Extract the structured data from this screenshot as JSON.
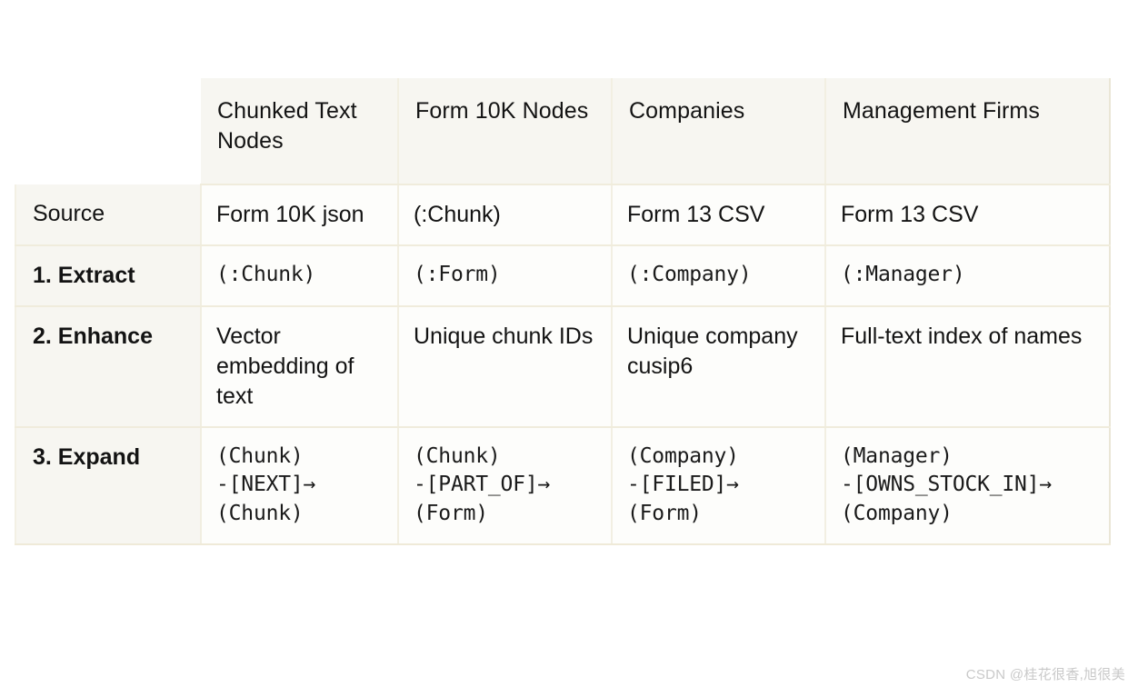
{
  "table": {
    "corner_label": "",
    "columns": [
      "Chunked Text Nodes",
      "Form 10K Nodes",
      "Companies",
      "Management Firms"
    ],
    "rows": [
      {
        "label": "Source",
        "bold": false,
        "mono": false,
        "cells": [
          "Form 10K json",
          "(:Chunk)",
          "Form 13 CSV",
          "Form 13 CSV"
        ]
      },
      {
        "label": "1. Extract",
        "bold": true,
        "mono": true,
        "cells": [
          "(:Chunk)",
          "(:Form)",
          "(:Company)",
          "(:Manager)"
        ]
      },
      {
        "label": "2. Enhance",
        "bold": true,
        "mono": false,
        "cells": [
          "Vector embedding of text",
          "Unique chunk IDs",
          "Unique company cusip6",
          "Full-text index of names"
        ]
      },
      {
        "label": "3. Expand",
        "bold": true,
        "mono": true,
        "cells": [
          "(Chunk)\n-[NEXT]→\n(Chunk)",
          "(Chunk)\n-[PART_OF]→\n(Form)",
          "(Company)\n-[FILED]→\n(Form)",
          "(Manager)\n-[OWNS_STOCK_IN]→\n(Company)"
        ]
      }
    ]
  },
  "watermark": {
    "text": "CSDN @桂花很香,旭很美"
  },
  "colors": {
    "page_background": "#ffffff",
    "header_background": "#f7f6f1",
    "label_background": "#f7f6f1",
    "cell_background": "#fdfdfb",
    "border": "#f0ecdc",
    "text": "#131313",
    "watermark": "#c9c9c9"
  }
}
